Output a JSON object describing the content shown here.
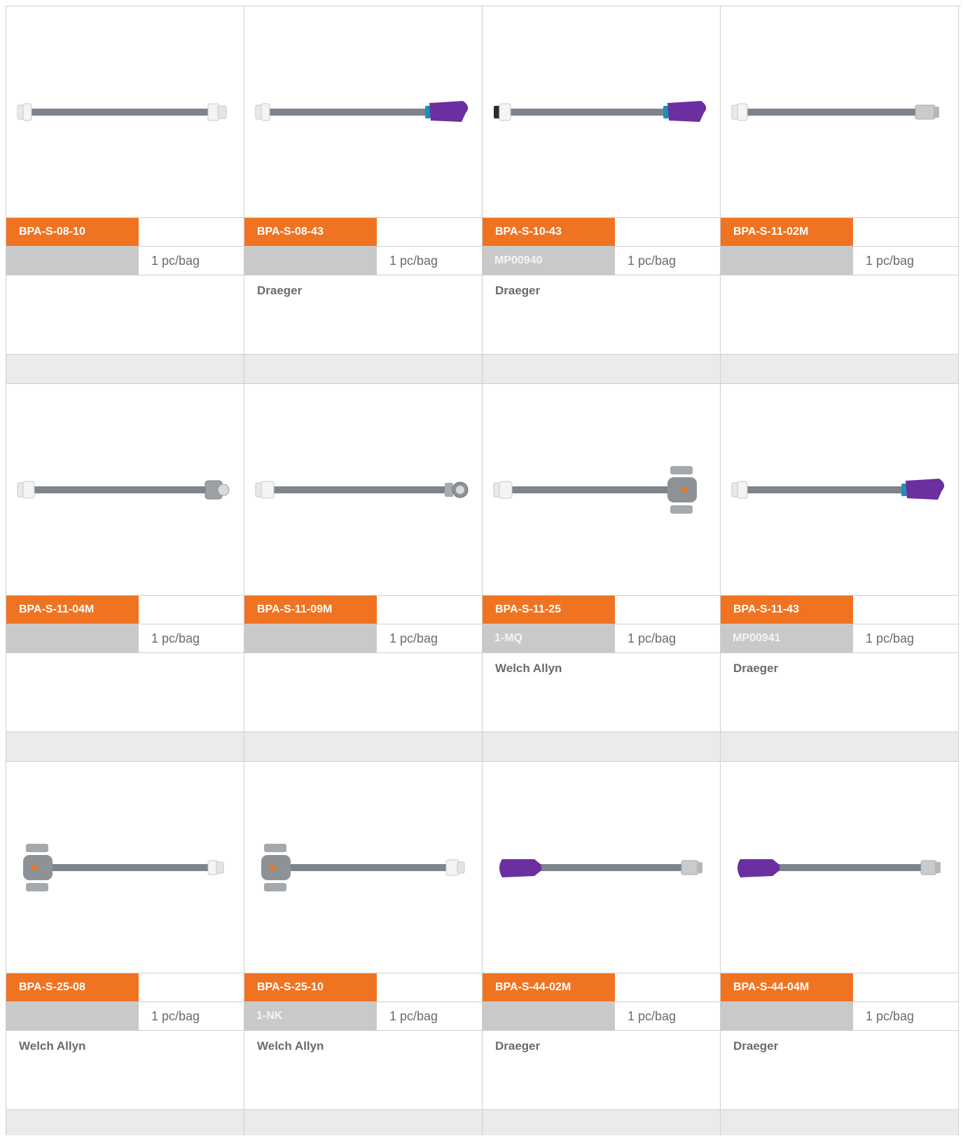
{
  "products": [
    {
      "code": "BPA-S-08-10",
      "ref": "",
      "pack": "1 pc/bag",
      "brand": "",
      "image": "hose-white-connectors-icon"
    },
    {
      "code": "BPA-S-08-43",
      "ref": "",
      "pack": "1 pc/bag",
      "brand": "Draeger",
      "image": "hose-purple-end-icon"
    },
    {
      "code": "BPA-S-10-43",
      "ref": "MP00940",
      "pack": "1 pc/bag",
      "brand": "Draeger",
      "image": "hose-purple-end-icon"
    },
    {
      "code": "BPA-S-11-02M",
      "ref": "",
      "pack": "1 pc/bag",
      "brand": "",
      "image": "hose-grey-connector-icon"
    },
    {
      "code": "BPA-S-11-04M",
      "ref": "",
      "pack": "1 pc/bag",
      "brand": "",
      "image": "hose-grey-knurled-icon"
    },
    {
      "code": "BPA-S-11-09M",
      "ref": "",
      "pack": "1 pc/bag",
      "brand": "",
      "image": "hose-bayonet-icon"
    },
    {
      "code": "BPA-S-11-25",
      "ref": "1-MQ",
      "pack": "1 pc/bag",
      "brand": "Welch Allyn",
      "image": "hose-clip-end-icon"
    },
    {
      "code": "BPA-S-11-43",
      "ref": "MP00941",
      "pack": "1 pc/bag",
      "brand": "Draeger",
      "image": "hose-purple-end-icon"
    },
    {
      "code": "BPA-S-25-08",
      "ref": "",
      "pack": "1 pc/bag",
      "brand": "Welch Allyn",
      "image": "hose-clip-start-icon"
    },
    {
      "code": "BPA-S-25-10",
      "ref": "1-NK",
      "pack": "1 pc/bag",
      "brand": "Welch Allyn",
      "image": "hose-clip-start-icon"
    },
    {
      "code": "BPA-S-44-02M",
      "ref": "",
      "pack": "1 pc/bag",
      "brand": "Draeger",
      "image": "hose-purple-start-icon"
    },
    {
      "code": "BPA-S-44-04M",
      "ref": "",
      "pack": "1 pc/bag",
      "brand": "Draeger",
      "image": "hose-purple-start-icon"
    }
  ],
  "colors": {
    "accent": "#f07322",
    "ref_bg": "#c9c9c9",
    "purple": "#6b2fa0",
    "hose": "#7d848b"
  }
}
